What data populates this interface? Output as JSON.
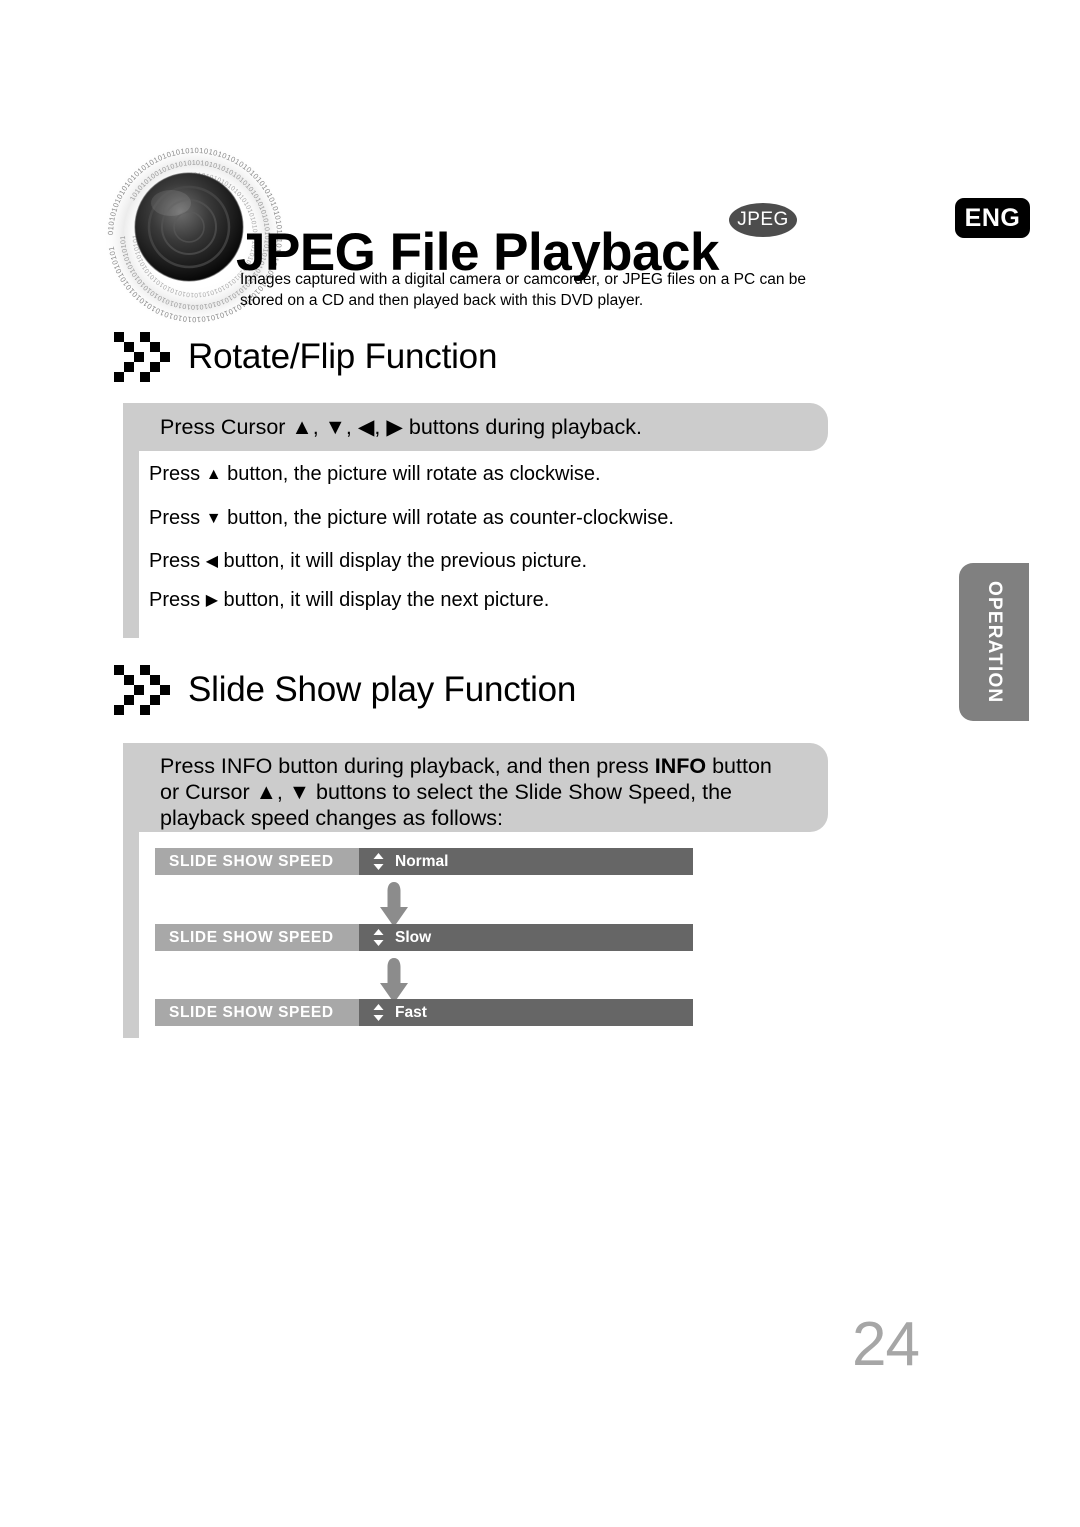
{
  "header": {
    "title": "JPEG File Playback",
    "format_badge": "JPEG",
    "language_badge": "ENG",
    "intro_line1": "Images captured with a digital camera or camcorder, or JPEG files on a PC can be",
    "intro_line2": "stored on a CD and then played back with this DVD player.",
    "disc_icon_name": "jpeg-disc-lens-logo"
  },
  "sections": [
    {
      "heading": "Rotate/Flip Function",
      "callout": "Press Cursor ▲, ▼, ◀, ▶ buttons during playback.",
      "instructions": [
        {
          "pre": "Press ",
          "arrow": "▲",
          "post": " button, the picture will rotate as clockwise."
        },
        {
          "pre": "Press ",
          "arrow": "▼",
          "post": " button, the picture will rotate as counter-clockwise."
        },
        {
          "pre": "Press ",
          "arrow": "◀",
          "post": " button, it will display the previous picture."
        },
        {
          "pre": "Press ",
          "arrow": "▶",
          "post": " button, it will display the next picture."
        }
      ]
    },
    {
      "heading": "Slide Show play Function",
      "callout_line1_a": "Press INFO button during playback, and then press ",
      "callout_line1_bold": "INFO",
      "callout_line1_b": " button",
      "callout_line2": "or Cursor ▲, ▼ buttons to select the Slide Show Speed,  the",
      "callout_line3": "playback speed changes as follows:"
    }
  ],
  "speed_bars": {
    "label": "SLIDE SHOW SPEED",
    "values": [
      "Normal",
      "Slow",
      "Fast"
    ]
  },
  "side_tab": {
    "label": "OPERATION"
  },
  "footer": {
    "page_number": "24"
  },
  "colors": {
    "callout_gray": "#cccccc",
    "rail_gray": "#cccccc",
    "bar_label_gray": "#a8a8a8",
    "bar_value_gray": "#666666",
    "side_tab_gray": "#808080",
    "page_number_gray": "#a6a6a6",
    "badge_black": "#000000",
    "jpeg_badge_gray": "#4d4d4d"
  }
}
